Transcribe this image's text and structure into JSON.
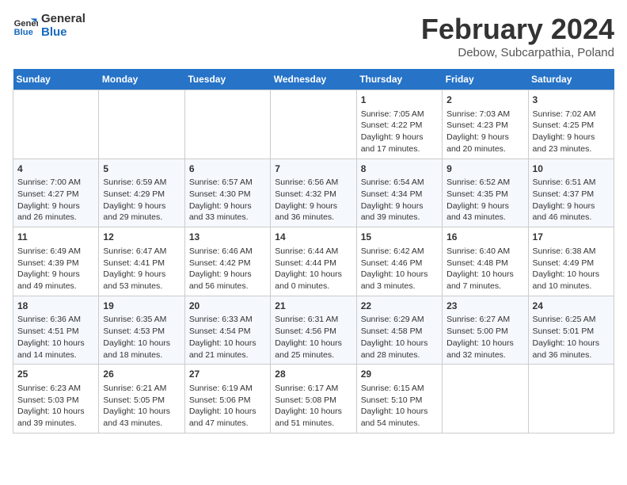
{
  "logo": {
    "line1": "General",
    "line2": "Blue"
  },
  "title": "February 2024",
  "subtitle": "Debow, Subcarpathia, Poland",
  "headers": [
    "Sunday",
    "Monday",
    "Tuesday",
    "Wednesday",
    "Thursday",
    "Friday",
    "Saturday"
  ],
  "weeks": [
    [
      {
        "day": "",
        "info": ""
      },
      {
        "day": "",
        "info": ""
      },
      {
        "day": "",
        "info": ""
      },
      {
        "day": "",
        "info": ""
      },
      {
        "day": "1",
        "info": "Sunrise: 7:05 AM\nSunset: 4:22 PM\nDaylight: 9 hours\nand 17 minutes."
      },
      {
        "day": "2",
        "info": "Sunrise: 7:03 AM\nSunset: 4:23 PM\nDaylight: 9 hours\nand 20 minutes."
      },
      {
        "day": "3",
        "info": "Sunrise: 7:02 AM\nSunset: 4:25 PM\nDaylight: 9 hours\nand 23 minutes."
      }
    ],
    [
      {
        "day": "4",
        "info": "Sunrise: 7:00 AM\nSunset: 4:27 PM\nDaylight: 9 hours\nand 26 minutes."
      },
      {
        "day": "5",
        "info": "Sunrise: 6:59 AM\nSunset: 4:29 PM\nDaylight: 9 hours\nand 29 minutes."
      },
      {
        "day": "6",
        "info": "Sunrise: 6:57 AM\nSunset: 4:30 PM\nDaylight: 9 hours\nand 33 minutes."
      },
      {
        "day": "7",
        "info": "Sunrise: 6:56 AM\nSunset: 4:32 PM\nDaylight: 9 hours\nand 36 minutes."
      },
      {
        "day": "8",
        "info": "Sunrise: 6:54 AM\nSunset: 4:34 PM\nDaylight: 9 hours\nand 39 minutes."
      },
      {
        "day": "9",
        "info": "Sunrise: 6:52 AM\nSunset: 4:35 PM\nDaylight: 9 hours\nand 43 minutes."
      },
      {
        "day": "10",
        "info": "Sunrise: 6:51 AM\nSunset: 4:37 PM\nDaylight: 9 hours\nand 46 minutes."
      }
    ],
    [
      {
        "day": "11",
        "info": "Sunrise: 6:49 AM\nSunset: 4:39 PM\nDaylight: 9 hours\nand 49 minutes."
      },
      {
        "day": "12",
        "info": "Sunrise: 6:47 AM\nSunset: 4:41 PM\nDaylight: 9 hours\nand 53 minutes."
      },
      {
        "day": "13",
        "info": "Sunrise: 6:46 AM\nSunset: 4:42 PM\nDaylight: 9 hours\nand 56 minutes."
      },
      {
        "day": "14",
        "info": "Sunrise: 6:44 AM\nSunset: 4:44 PM\nDaylight: 10 hours\nand 0 minutes."
      },
      {
        "day": "15",
        "info": "Sunrise: 6:42 AM\nSunset: 4:46 PM\nDaylight: 10 hours\nand 3 minutes."
      },
      {
        "day": "16",
        "info": "Sunrise: 6:40 AM\nSunset: 4:48 PM\nDaylight: 10 hours\nand 7 minutes."
      },
      {
        "day": "17",
        "info": "Sunrise: 6:38 AM\nSunset: 4:49 PM\nDaylight: 10 hours\nand 10 minutes."
      }
    ],
    [
      {
        "day": "18",
        "info": "Sunrise: 6:36 AM\nSunset: 4:51 PM\nDaylight: 10 hours\nand 14 minutes."
      },
      {
        "day": "19",
        "info": "Sunrise: 6:35 AM\nSunset: 4:53 PM\nDaylight: 10 hours\nand 18 minutes."
      },
      {
        "day": "20",
        "info": "Sunrise: 6:33 AM\nSunset: 4:54 PM\nDaylight: 10 hours\nand 21 minutes."
      },
      {
        "day": "21",
        "info": "Sunrise: 6:31 AM\nSunset: 4:56 PM\nDaylight: 10 hours\nand 25 minutes."
      },
      {
        "day": "22",
        "info": "Sunrise: 6:29 AM\nSunset: 4:58 PM\nDaylight: 10 hours\nand 28 minutes."
      },
      {
        "day": "23",
        "info": "Sunrise: 6:27 AM\nSunset: 5:00 PM\nDaylight: 10 hours\nand 32 minutes."
      },
      {
        "day": "24",
        "info": "Sunrise: 6:25 AM\nSunset: 5:01 PM\nDaylight: 10 hours\nand 36 minutes."
      }
    ],
    [
      {
        "day": "25",
        "info": "Sunrise: 6:23 AM\nSunset: 5:03 PM\nDaylight: 10 hours\nand 39 minutes."
      },
      {
        "day": "26",
        "info": "Sunrise: 6:21 AM\nSunset: 5:05 PM\nDaylight: 10 hours\nand 43 minutes."
      },
      {
        "day": "27",
        "info": "Sunrise: 6:19 AM\nSunset: 5:06 PM\nDaylight: 10 hours\nand 47 minutes."
      },
      {
        "day": "28",
        "info": "Sunrise: 6:17 AM\nSunset: 5:08 PM\nDaylight: 10 hours\nand 51 minutes."
      },
      {
        "day": "29",
        "info": "Sunrise: 6:15 AM\nSunset: 5:10 PM\nDaylight: 10 hours\nand 54 minutes."
      },
      {
        "day": "",
        "info": ""
      },
      {
        "day": "",
        "info": ""
      }
    ]
  ]
}
